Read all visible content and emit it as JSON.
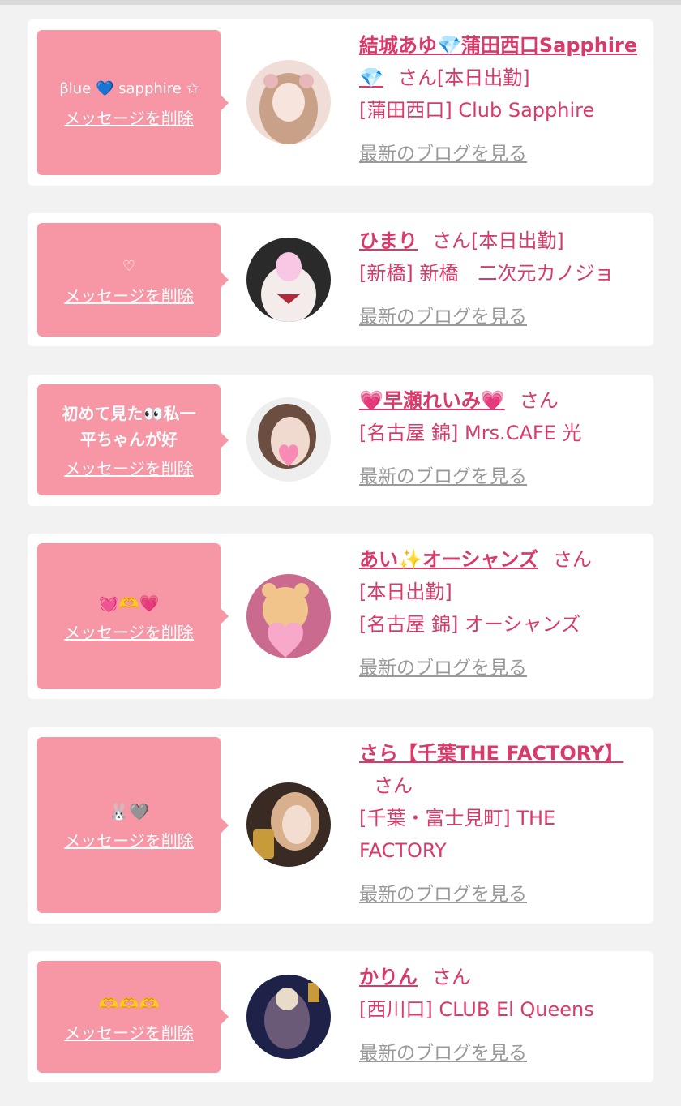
{
  "entries": [
    {
      "message": "βlue 💙 sapphire ✩",
      "delete_label": "メッセージを削除",
      "name": "結城あゆ💎蒲田西口Sapphire💎",
      "honorific": "さん",
      "status": "[本日出勤]",
      "shop": "[蒲田西口] Club Sapphire",
      "blog_label": "最新のブログを見る"
    },
    {
      "message": "♡",
      "delete_label": "メッセージを削除",
      "name": "ひまり",
      "honorific": "さん",
      "status": "[本日出勤]",
      "shop": "[新橋] 新橋　二次元カノジョ",
      "blog_label": "最新のブログを見る"
    },
    {
      "message": "初めて見た👀私一\n平ちゃんが好",
      "delete_label": "メッセージを削除",
      "name": "💗早瀬れいみ💗",
      "honorific": "さん",
      "status": "",
      "shop": "[名古屋 錦] Mrs.CAFE 光",
      "blog_label": "最新のブログを見る"
    },
    {
      "message": "💓🫶💗",
      "delete_label": "メッセージを削除",
      "name": "あい✨オーシャンズ",
      "honorific": "さん",
      "status": "[本日出勤]",
      "shop": "[名古屋 錦] オーシャンズ",
      "blog_label": "最新のブログを見る"
    },
    {
      "message": "🐰🩶",
      "delete_label": "メッセージを削除",
      "name": "さら【千葉THE FACTORY】",
      "honorific": "さん",
      "status": "",
      "shop": "[千葉・富士見町] THE FACTORY",
      "blog_label": "最新のブログを見る"
    },
    {
      "message": "🫶🫶🫶",
      "delete_label": "メッセージを削除",
      "name": "かりん",
      "honorific": "さん",
      "status": "",
      "shop": "[西川口] CLUB El Queens",
      "blog_label": "最新のブログを見る"
    }
  ]
}
